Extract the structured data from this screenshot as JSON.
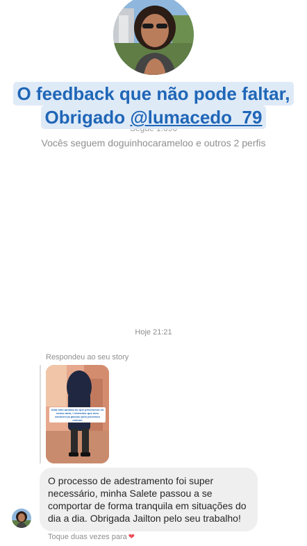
{
  "profile": {
    "followers_text": "Segue 1.096",
    "mutual_text": "Vocês seguem doguinhocarameloo e outros 2 perfis"
  },
  "overlay": {
    "line1": "O feedback que não pode faltar,",
    "line2_prefix": "Obrigado ",
    "line2_handle": "@lumacedo_79"
  },
  "chat": {
    "timestamp": "Hoje 21:21",
    "replied_label": "Respondeu ao seu story",
    "story_caption": "Uma mini audiola do que presenciou no nosso auto, I entendeu que meu cachorro já passou pelo processo comum",
    "message": "O processo de adestramento foi super necessário, minha Salete passou a se comportar de forma tranquila em situações do dia a dia. Obrigada Jailton pelo seu trabalho!",
    "like_hint": "Toque duas vezes para",
    "like_icon": "heart-icon"
  },
  "colors": {
    "overlay_text": "#1f66b7",
    "overlay_bg": "#dce8f6",
    "bubble_bg": "#efefef",
    "heart": "#ed4956"
  }
}
